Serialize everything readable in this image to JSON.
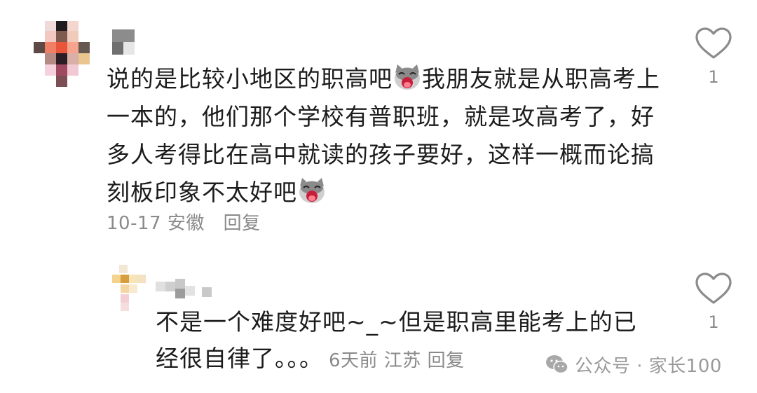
{
  "comments": [
    {
      "text_part1": "说的是比较小地区的职高吧",
      "emoji_1": "cat-face-emoji",
      "text_part2": "我朋友就是从职高考上一本的，他们那个学校有普职班，就是攻高考了，好多人考得比在高中就读的孩子要好，这样一概而论搞刻板印象不太好吧",
      "emoji_2": "cat-face-emoji",
      "date": "10-17",
      "location": "安徽",
      "reply_label": "回复",
      "like_count": "1"
    },
    {
      "text": "不是一个难度好吧~_~但是职高里能考上的已经很自律了。。。",
      "meta": "6天前 江苏 回复",
      "like_count": "1"
    }
  ],
  "watermark": {
    "text": "公众号 · 家长100",
    "icon": "wechat-icon"
  }
}
